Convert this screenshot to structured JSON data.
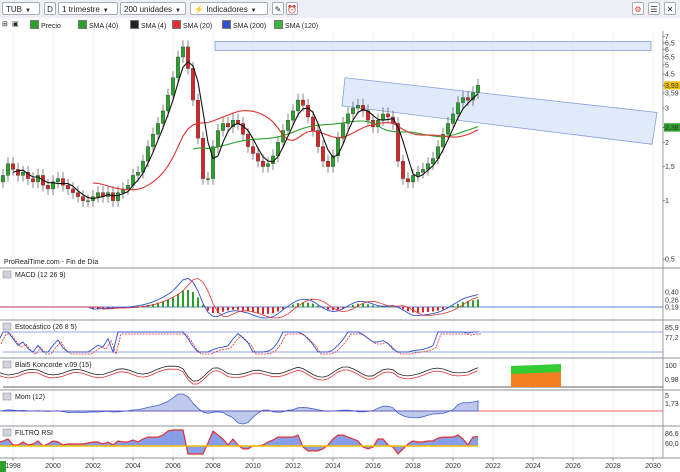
{
  "toolbar": {
    "symbol": "TUB",
    "d_label": "D",
    "period": "1 trimestre",
    "units": "200 unidades",
    "indicators": "Indicadores"
  },
  "legend": [
    {
      "label": "Precio",
      "color": "#2ca02c"
    },
    {
      "label": "SMA (40)",
      "color": "#2ca02c"
    },
    {
      "label": "SMA (4)",
      "color": "#222222"
    },
    {
      "label": "SMA (20)",
      "color": "#e03030"
    },
    {
      "label": "SMA (200)",
      "color": "#3050d0"
    },
    {
      "label": "SMA (120)",
      "color": "#3cb43c"
    }
  ],
  "source_label": "ProRealTime.com - Fin de Día",
  "panels": {
    "macd": {
      "title": "MACD (12 26 9)",
      "values": [
        "0,40",
        "0,26",
        "0,19"
      ]
    },
    "stoch": {
      "title": "Estocástico (26 8 5)",
      "values": [
        "85,9",
        "77,2"
      ]
    },
    "blai": {
      "title": "Blai5 Koncorde v.09 (15)",
      "values": [
        "100",
        "0,98"
      ]
    },
    "mom": {
      "title": "Mom (12)",
      "values": [
        "5",
        "1,73"
      ]
    },
    "rsi": {
      "title": "FILTRO RSI",
      "values": [
        "86,6",
        "60,0"
      ]
    }
  },
  "price_axis": {
    "ticks": [
      "7",
      "6,5",
      "6",
      "5,5",
      "5",
      "4,5",
      "3,93",
      "3,59",
      "3",
      "2,39",
      "2,38",
      "2",
      "1,5",
      "1",
      "0,5"
    ],
    "highlight_labels": [
      {
        "text": "3,93",
        "color": "#f0c000"
      },
      {
        "text": "2,39",
        "color": "#2ca02c"
      },
      {
        "text": "2,38",
        "color": "#2ca02c"
      }
    ]
  },
  "time_axis": {
    "ticks": [
      "1998",
      "2000",
      "2002",
      "2004",
      "2006",
      "2008",
      "2010",
      "2012",
      "2014",
      "2016",
      "2018",
      "2020",
      "2022",
      "2024",
      "2026",
      "2028",
      "2030"
    ]
  },
  "colors": {
    "up": "#2ca02c",
    "down": "#d62728",
    "sma4": "#111111",
    "sma20": "#e03030",
    "sma40": "#2ca02c",
    "sma120": "#3cb43c",
    "channel_fill": "#dce7fb",
    "channel_stroke": "#6f8fd8"
  },
  "chart_data": {
    "type": "candlestick",
    "frequency": "quarterly",
    "x_range": [
      1997.5,
      2030.5
    ],
    "y_scale": "log",
    "y_range": [
      0.5,
      7
    ],
    "last_close": 3.93,
    "quarters_start": 1997.25,
    "closes": [
      1.25,
      1.35,
      1.55,
      1.45,
      1.35,
      1.4,
      1.3,
      1.25,
      1.35,
      1.2,
      1.15,
      1.25,
      1.3,
      1.2,
      1.15,
      1.1,
      1.05,
      1.0,
      1.0,
      1.05,
      1.1,
      1.05,
      1.1,
      1.0,
      1.1,
      1.15,
      1.2,
      1.35,
      1.4,
      1.6,
      1.9,
      2.2,
      2.5,
      2.9,
      3.5,
      4.3,
      5.5,
      6.2,
      4.8,
      3.3,
      2.1,
      1.3,
      1.3,
      1.9,
      2.3,
      2.5,
      2.4,
      2.6,
      2.5,
      2.2,
      1.9,
      1.75,
      1.6,
      1.5,
      1.55,
      1.7,
      2.0,
      2.3,
      2.6,
      2.9,
      3.3,
      3.1,
      2.7,
      2.3,
      1.9,
      1.6,
      1.5,
      1.7,
      2.1,
      2.5,
      2.8,
      3.0,
      3.1,
      2.9,
      2.6,
      2.4,
      2.6,
      2.8,
      2.7,
      2.5,
      1.6,
      1.3,
      1.25,
      1.35,
      1.4,
      1.45,
      1.55,
      1.65,
      1.9,
      2.2,
      2.5,
      2.8,
      3.2,
      3.4,
      3.3,
      3.6,
      3.93
    ],
    "sma_periods": [
      4,
      20,
      40
    ],
    "channel_2008_zone": {
      "x": [
        2008.1,
        2030.5
      ],
      "y": [
        5.95,
        6.6
      ]
    },
    "channel_desc": {
      "start": [
        2014.6,
        4.3
      ],
      "end": [
        2030.2,
        2.85
      ],
      "width_y": 0.75
    },
    "indicators": {
      "macd_levels": [
        0.4,
        0.26,
        0.19
      ],
      "stoch_levels": [
        85.9,
        77.2
      ],
      "blai_level": 0.98,
      "mom_level": 1.73,
      "rsi_levels": [
        86.6,
        60.0
      ]
    }
  }
}
